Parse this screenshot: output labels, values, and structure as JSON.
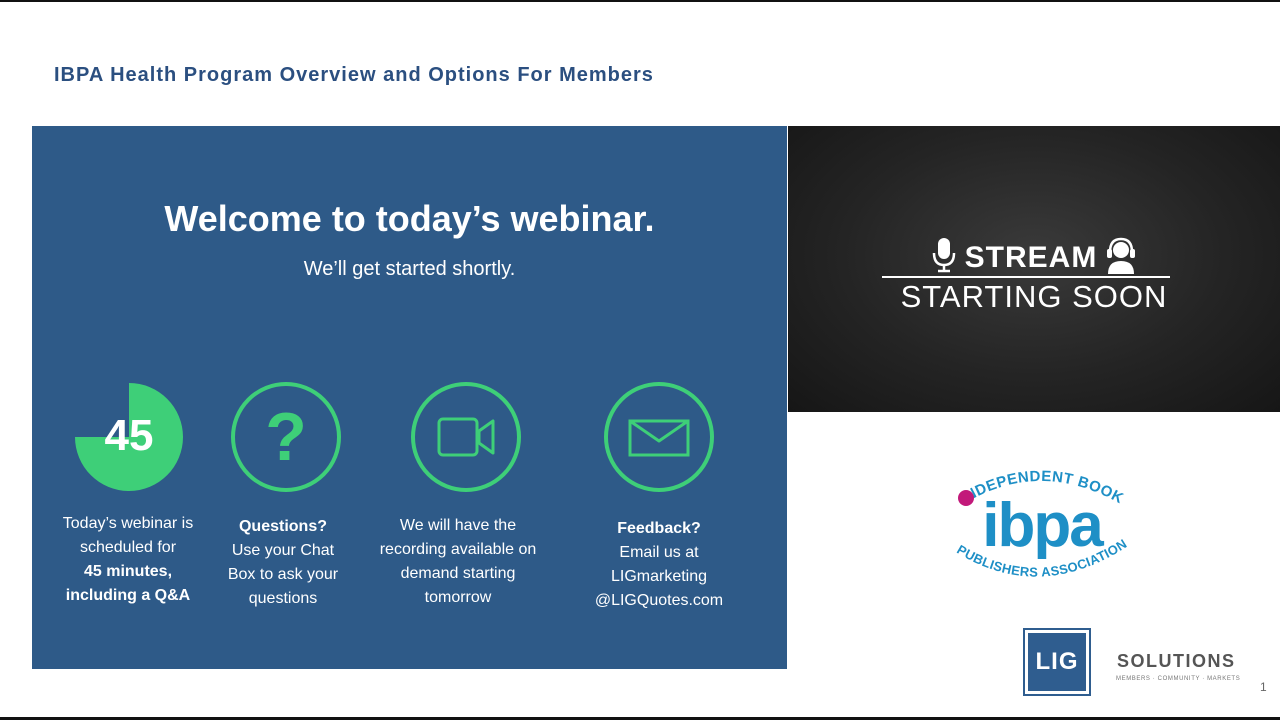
{
  "slide": {
    "title": "IBPA Health Program Overview and Options For Members",
    "page_number": "1"
  },
  "welcome": {
    "heading": "Welcome to today’s webinar.",
    "subheading": "We’ll get started shortly."
  },
  "timer": {
    "minutes": "45",
    "fraction_filled": 0.75
  },
  "items": [
    {
      "icon": "timer-icon",
      "lines": [
        "Today’s webinar is",
        "scheduled for"
      ],
      "bold": [
        "45 minutes,",
        "including a Q&A"
      ]
    },
    {
      "icon": "question-icon",
      "bold_title": "Questions?",
      "lines": [
        "Use your Chat",
        "Box to ask your",
        "questions"
      ]
    },
    {
      "icon": "video-camera-icon",
      "lines": [
        "We will have the",
        "recording available on",
        "demand starting",
        "tomorrow"
      ]
    },
    {
      "icon": "envelope-icon",
      "bold_title": "Feedback?",
      "lines": [
        "Email us at",
        "LIGmarketing",
        "@LIGQuotes.com"
      ]
    }
  ],
  "stream": {
    "top": "STREAM",
    "bottom": "STARTING SOON",
    "icons": [
      "microphone-icon",
      "headset-icon"
    ]
  },
  "ibpa_logo": {
    "arc_top": "INDEPENDENT BOOK",
    "wordmark": "ibpa",
    "arc_bottom": "PUBLISHERS ASSOCIATION"
  },
  "lig": {
    "box_text": "LIG",
    "solutions": "SOLUTIONS",
    "tagline": "MEMBERS · COMMUNITY · MARKETS"
  },
  "colors": {
    "panel_blue": "#2e5a88",
    "accent_green": "#3ecf78",
    "title_blue": "#2b4f80",
    "ibpa_blue": "#1e8fc6",
    "ibpa_magenta": "#c2197a",
    "lig_blue": "#2f5d8f"
  }
}
